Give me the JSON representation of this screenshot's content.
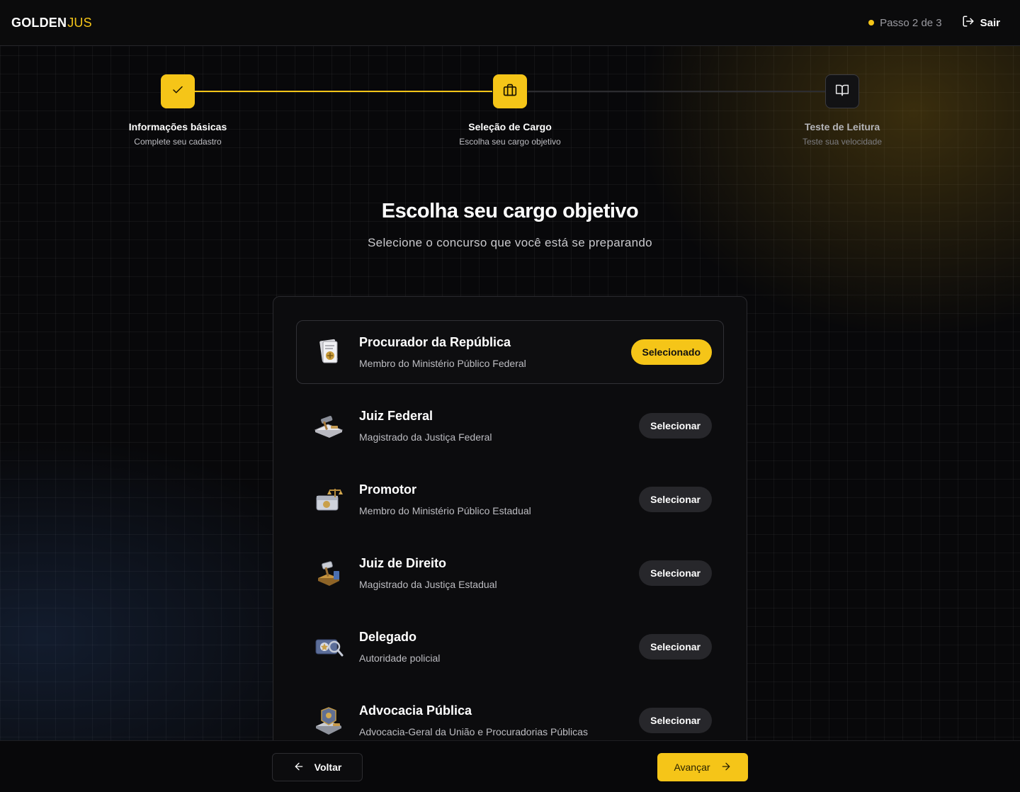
{
  "header": {
    "logo_main": "GOLDEN",
    "logo_accent": "JUS",
    "step_indicator": "Passo 2 de 3",
    "logout_label": "Sair"
  },
  "stepper": {
    "steps": [
      {
        "title": "Informações básicas",
        "subtitle": "Complete seu cadastro",
        "state": "done",
        "icon": "check-icon"
      },
      {
        "title": "Seleção de Cargo",
        "subtitle": "Escolha seu cargo objetivo",
        "state": "active",
        "icon": "briefcase-icon"
      },
      {
        "title": "Teste de Leitura",
        "subtitle": "Teste sua velocidade",
        "state": "pending",
        "icon": "book-open-icon"
      }
    ]
  },
  "main": {
    "title": "Escolha seu cargo objetivo",
    "subtitle": "Selecione o concurso que você está se preparando"
  },
  "options": [
    {
      "title": "Procurador da República",
      "subtitle": "Membro do Ministério Público Federal",
      "button": "Selecionado",
      "selected": true,
      "icon": "document-scale-icon"
    },
    {
      "title": "Juiz Federal",
      "subtitle": "Magistrado da Justiça Federal",
      "button": "Selecionar",
      "selected": false,
      "icon": "gavel-book-icon"
    },
    {
      "title": "Promotor",
      "subtitle": "Membro do Ministério Público Estadual",
      "button": "Selecionar",
      "selected": false,
      "icon": "scale-briefcase-icon"
    },
    {
      "title": "Juiz de Direito",
      "subtitle": "Magistrado da Justiça Estadual",
      "button": "Selecionar",
      "selected": false,
      "icon": "gavel-stand-icon"
    },
    {
      "title": "Delegado",
      "subtitle": "Autoridade policial",
      "button": "Selecionar",
      "selected": false,
      "icon": "police-badge-icon"
    },
    {
      "title": "Advocacia Pública",
      "subtitle": "Advocacia-Geral da União e Procuradorias Públicas",
      "button": "Selecionar",
      "selected": false,
      "icon": "law-seal-icon"
    }
  ],
  "footer": {
    "back_label": "Voltar",
    "next_label": "Avançar"
  },
  "colors": {
    "accent": "#f5c518",
    "background": "#08080a",
    "card": "#0c0c0e"
  }
}
